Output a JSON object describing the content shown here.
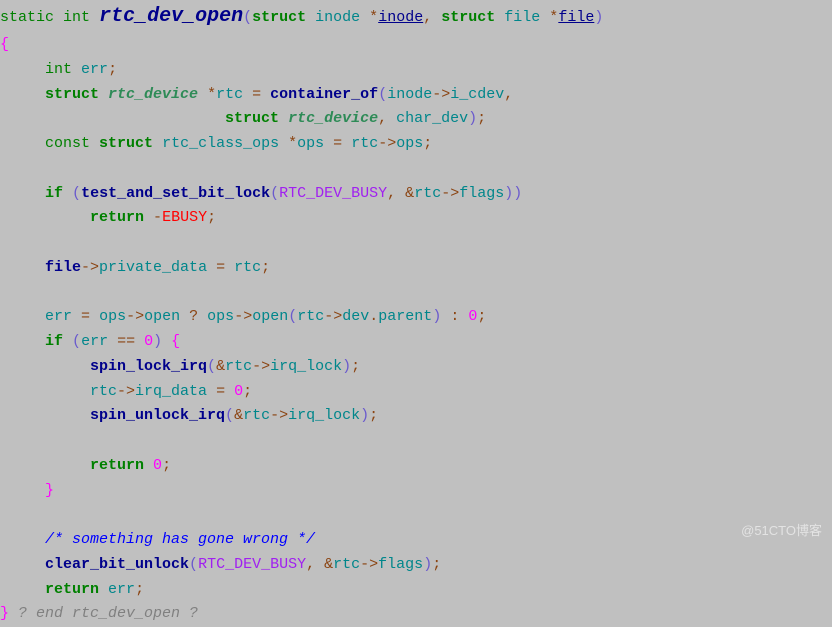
{
  "t": {
    "static": "static",
    "int": "int",
    "struct": "struct",
    "const": "const",
    "if": "if",
    "return": "return",
    "fn_name": "rtc_dev_open",
    "inode": "inode",
    "file": "file",
    "err": "err",
    "rtc_device": "rtc_device",
    "rtc": "rtc",
    "container_of": "container_of",
    "i_cdev": "i_cdev",
    "char_dev": "char_dev",
    "rtc_class_ops": "rtc_class_ops",
    "ops": "ops",
    "test_and_set_bit_lock": "test_and_set_bit_lock",
    "RTC_DEV_BUSY": "RTC_DEV_BUSY",
    "flags": "flags",
    "EBUSY": "EBUSY",
    "private_data": "private_data",
    "open": "open",
    "dev": "dev",
    "parent": "parent",
    "zero": "0",
    "eqeq": "==",
    "spin_lock_irq": "spin_lock_irq",
    "irq_lock": "irq_lock",
    "irq_data": "irq_data",
    "spin_unlock_irq": "spin_unlock_irq",
    "cmt_wrong": "/* something has gone wrong */",
    "clear_bit_unlock": "clear_bit_unlock",
    "end_cmt": "? end rtc_dev_open ?",
    "amp": "&",
    "arrow": "->",
    "star": "*",
    "eq": "=",
    "comma": ",",
    "semi": ";",
    "minus": "-",
    "qmark": "?",
    "colon": ":",
    "lb": "{",
    "rb": "}",
    "lp": "(",
    "rp": ")"
  },
  "watermark": "@51CTO博客"
}
